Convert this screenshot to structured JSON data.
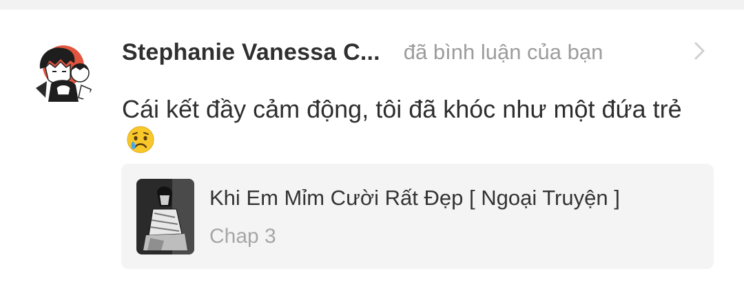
{
  "notification": {
    "user_name": "Stephanie Vanessa C...",
    "action": "đã bình luận của bạn",
    "comment": "Cái kết đầy cảm động, tôi đã khóc như một đứa trẻ",
    "emoji": "crying-face-emoji",
    "icons": {
      "avatar": "avatar-manga-image",
      "chevron": "chevron-right-icon",
      "thumbnail": "comic-thumbnail-image"
    },
    "card": {
      "title": "Khi Em Mỉm Cười Rất Đẹp [ Ngoại Truyện ]",
      "chapter": "Chap 3"
    }
  },
  "colors": {
    "name": "#2f2f2f",
    "muted": "#9c9c9c",
    "card_bg": "#f4f4f5",
    "avatar_accent": "#e2553f"
  }
}
